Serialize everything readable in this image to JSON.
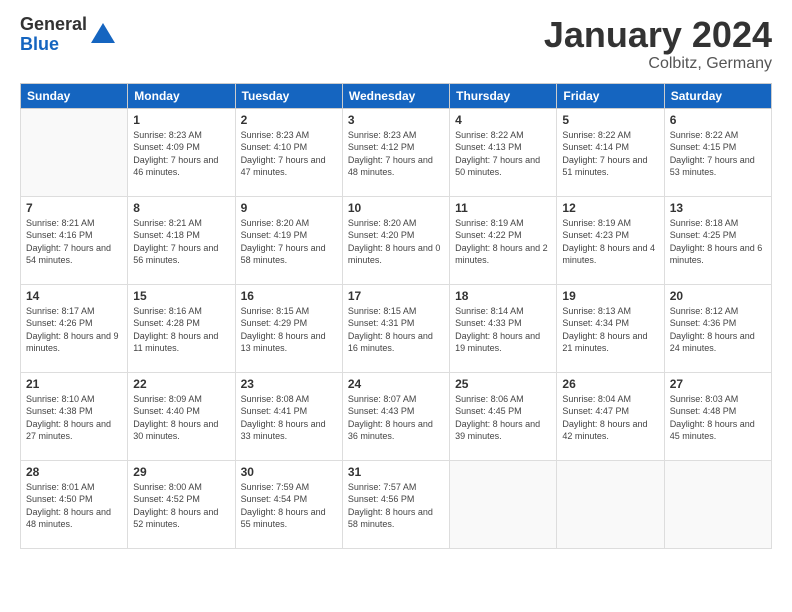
{
  "logo": {
    "general": "General",
    "blue": "Blue"
  },
  "title": "January 2024",
  "subtitle": "Colbitz, Germany",
  "header_days": [
    "Sunday",
    "Monday",
    "Tuesday",
    "Wednesday",
    "Thursday",
    "Friday",
    "Saturday"
  ],
  "weeks": [
    [
      {
        "day": "",
        "sunrise": "",
        "sunset": "",
        "daylight": ""
      },
      {
        "day": "1",
        "sunrise": "Sunrise: 8:23 AM",
        "sunset": "Sunset: 4:09 PM",
        "daylight": "Daylight: 7 hours and 46 minutes."
      },
      {
        "day": "2",
        "sunrise": "Sunrise: 8:23 AM",
        "sunset": "Sunset: 4:10 PM",
        "daylight": "Daylight: 7 hours and 47 minutes."
      },
      {
        "day": "3",
        "sunrise": "Sunrise: 8:23 AM",
        "sunset": "Sunset: 4:12 PM",
        "daylight": "Daylight: 7 hours and 48 minutes."
      },
      {
        "day": "4",
        "sunrise": "Sunrise: 8:22 AM",
        "sunset": "Sunset: 4:13 PM",
        "daylight": "Daylight: 7 hours and 50 minutes."
      },
      {
        "day": "5",
        "sunrise": "Sunrise: 8:22 AM",
        "sunset": "Sunset: 4:14 PM",
        "daylight": "Daylight: 7 hours and 51 minutes."
      },
      {
        "day": "6",
        "sunrise": "Sunrise: 8:22 AM",
        "sunset": "Sunset: 4:15 PM",
        "daylight": "Daylight: 7 hours and 53 minutes."
      }
    ],
    [
      {
        "day": "7",
        "sunrise": "Sunrise: 8:21 AM",
        "sunset": "Sunset: 4:16 PM",
        "daylight": "Daylight: 7 hours and 54 minutes."
      },
      {
        "day": "8",
        "sunrise": "Sunrise: 8:21 AM",
        "sunset": "Sunset: 4:18 PM",
        "daylight": "Daylight: 7 hours and 56 minutes."
      },
      {
        "day": "9",
        "sunrise": "Sunrise: 8:20 AM",
        "sunset": "Sunset: 4:19 PM",
        "daylight": "Daylight: 7 hours and 58 minutes."
      },
      {
        "day": "10",
        "sunrise": "Sunrise: 8:20 AM",
        "sunset": "Sunset: 4:20 PM",
        "daylight": "Daylight: 8 hours and 0 minutes."
      },
      {
        "day": "11",
        "sunrise": "Sunrise: 8:19 AM",
        "sunset": "Sunset: 4:22 PM",
        "daylight": "Daylight: 8 hours and 2 minutes."
      },
      {
        "day": "12",
        "sunrise": "Sunrise: 8:19 AM",
        "sunset": "Sunset: 4:23 PM",
        "daylight": "Daylight: 8 hours and 4 minutes."
      },
      {
        "day": "13",
        "sunrise": "Sunrise: 8:18 AM",
        "sunset": "Sunset: 4:25 PM",
        "daylight": "Daylight: 8 hours and 6 minutes."
      }
    ],
    [
      {
        "day": "14",
        "sunrise": "Sunrise: 8:17 AM",
        "sunset": "Sunset: 4:26 PM",
        "daylight": "Daylight: 8 hours and 9 minutes."
      },
      {
        "day": "15",
        "sunrise": "Sunrise: 8:16 AM",
        "sunset": "Sunset: 4:28 PM",
        "daylight": "Daylight: 8 hours and 11 minutes."
      },
      {
        "day": "16",
        "sunrise": "Sunrise: 8:15 AM",
        "sunset": "Sunset: 4:29 PM",
        "daylight": "Daylight: 8 hours and 13 minutes."
      },
      {
        "day": "17",
        "sunrise": "Sunrise: 8:15 AM",
        "sunset": "Sunset: 4:31 PM",
        "daylight": "Daylight: 8 hours and 16 minutes."
      },
      {
        "day": "18",
        "sunrise": "Sunrise: 8:14 AM",
        "sunset": "Sunset: 4:33 PM",
        "daylight": "Daylight: 8 hours and 19 minutes."
      },
      {
        "day": "19",
        "sunrise": "Sunrise: 8:13 AM",
        "sunset": "Sunset: 4:34 PM",
        "daylight": "Daylight: 8 hours and 21 minutes."
      },
      {
        "day": "20",
        "sunrise": "Sunrise: 8:12 AM",
        "sunset": "Sunset: 4:36 PM",
        "daylight": "Daylight: 8 hours and 24 minutes."
      }
    ],
    [
      {
        "day": "21",
        "sunrise": "Sunrise: 8:10 AM",
        "sunset": "Sunset: 4:38 PM",
        "daylight": "Daylight: 8 hours and 27 minutes."
      },
      {
        "day": "22",
        "sunrise": "Sunrise: 8:09 AM",
        "sunset": "Sunset: 4:40 PM",
        "daylight": "Daylight: 8 hours and 30 minutes."
      },
      {
        "day": "23",
        "sunrise": "Sunrise: 8:08 AM",
        "sunset": "Sunset: 4:41 PM",
        "daylight": "Daylight: 8 hours and 33 minutes."
      },
      {
        "day": "24",
        "sunrise": "Sunrise: 8:07 AM",
        "sunset": "Sunset: 4:43 PM",
        "daylight": "Daylight: 8 hours and 36 minutes."
      },
      {
        "day": "25",
        "sunrise": "Sunrise: 8:06 AM",
        "sunset": "Sunset: 4:45 PM",
        "daylight": "Daylight: 8 hours and 39 minutes."
      },
      {
        "day": "26",
        "sunrise": "Sunrise: 8:04 AM",
        "sunset": "Sunset: 4:47 PM",
        "daylight": "Daylight: 8 hours and 42 minutes."
      },
      {
        "day": "27",
        "sunrise": "Sunrise: 8:03 AM",
        "sunset": "Sunset: 4:48 PM",
        "daylight": "Daylight: 8 hours and 45 minutes."
      }
    ],
    [
      {
        "day": "28",
        "sunrise": "Sunrise: 8:01 AM",
        "sunset": "Sunset: 4:50 PM",
        "daylight": "Daylight: 8 hours and 48 minutes."
      },
      {
        "day": "29",
        "sunrise": "Sunrise: 8:00 AM",
        "sunset": "Sunset: 4:52 PM",
        "daylight": "Daylight: 8 hours and 52 minutes."
      },
      {
        "day": "30",
        "sunrise": "Sunrise: 7:59 AM",
        "sunset": "Sunset: 4:54 PM",
        "daylight": "Daylight: 8 hours and 55 minutes."
      },
      {
        "day": "31",
        "sunrise": "Sunrise: 7:57 AM",
        "sunset": "Sunset: 4:56 PM",
        "daylight": "Daylight: 8 hours and 58 minutes."
      },
      {
        "day": "",
        "sunrise": "",
        "sunset": "",
        "daylight": ""
      },
      {
        "day": "",
        "sunrise": "",
        "sunset": "",
        "daylight": ""
      },
      {
        "day": "",
        "sunrise": "",
        "sunset": "",
        "daylight": ""
      }
    ]
  ]
}
